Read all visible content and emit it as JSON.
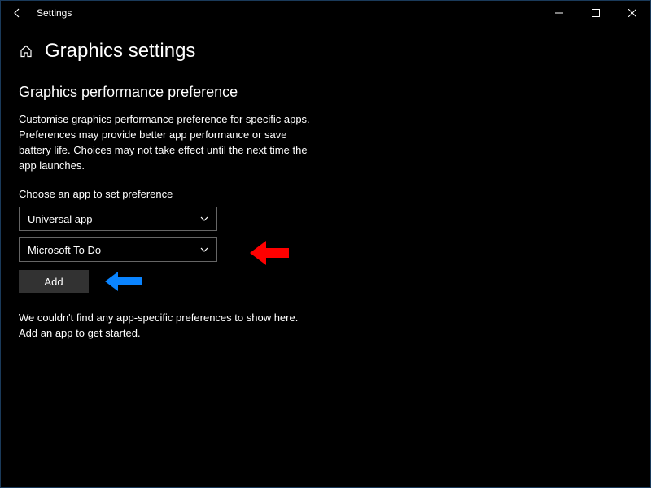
{
  "titlebar": {
    "title": "Settings"
  },
  "page": {
    "title": "Graphics settings"
  },
  "section": {
    "title": "Graphics performance preference",
    "description": "Customise graphics performance preference for specific apps. Preferences may provide better app performance or save battery life. Choices may not take effect until the next time the app launches."
  },
  "choose": {
    "label": "Choose an app to set preference",
    "appType": "Universal app",
    "appName": "Microsoft To Do",
    "addLabel": "Add"
  },
  "empty": {
    "message": "We couldn't find any app-specific preferences to show here. Add an app to get started."
  },
  "annotations": {
    "redArrowColor": "#ff0000",
    "blueArrowColor": "#0a84ff"
  }
}
